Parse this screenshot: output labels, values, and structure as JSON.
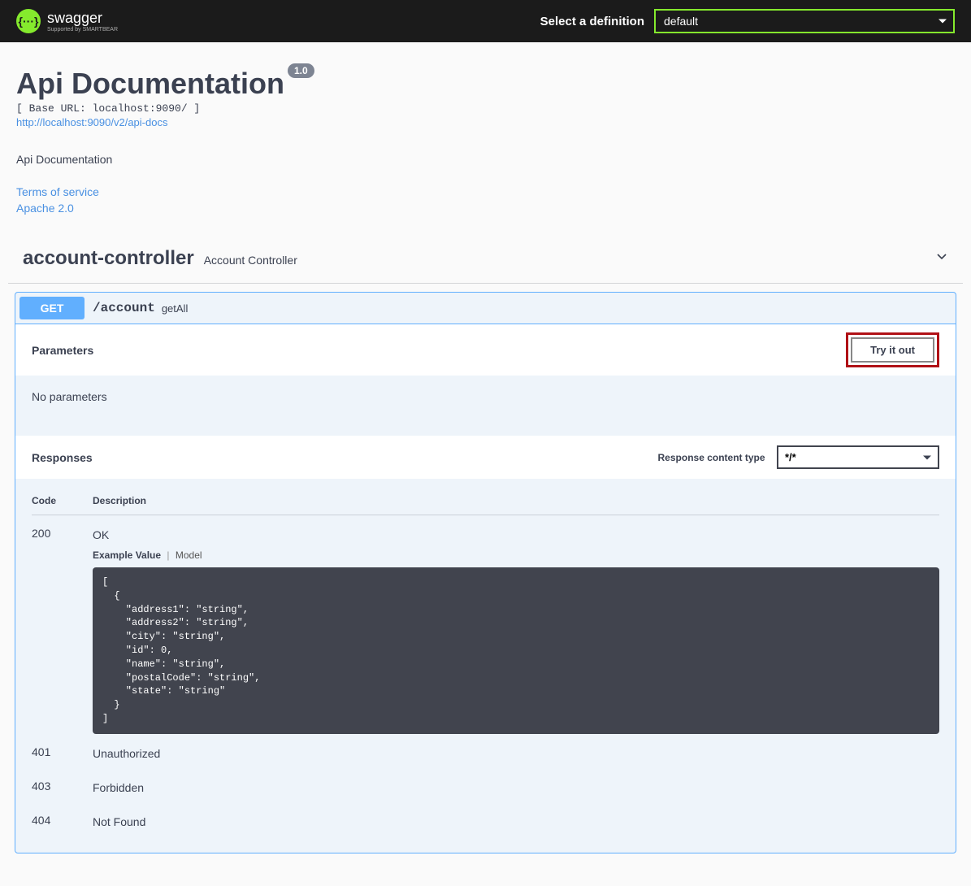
{
  "topbar": {
    "logo_text": "swagger",
    "logo_sub": "Supported by SMARTBEAR",
    "select_label": "Select a definition",
    "definition": "default"
  },
  "info": {
    "title": "Api Documentation",
    "version": "1.0",
    "base_url": "[ Base URL: localhost:9090/ ]",
    "docs_link": "http://localhost:9090/v2/api-docs",
    "description": "Api Documentation",
    "tos_label": "Terms of service",
    "license_label": "Apache 2.0"
  },
  "tag": {
    "name": "account-controller",
    "description": "Account Controller"
  },
  "operation": {
    "method": "GET",
    "path": "/account",
    "summary": "getAll",
    "parameters_label": "Parameters",
    "try_it_label": "Try it out",
    "no_params": "No parameters",
    "responses_label": "Responses",
    "content_type_label": "Response content type",
    "content_type_value": "*/*",
    "table": {
      "code_header": "Code",
      "desc_header": "Description"
    },
    "example_value_label": "Example Value",
    "model_label": "Model",
    "responses": {
      "r200": {
        "code": "200",
        "description": "OK"
      },
      "r401": {
        "code": "401",
        "description": "Unauthorized"
      },
      "r403": {
        "code": "403",
        "description": "Forbidden"
      },
      "r404": {
        "code": "404",
        "description": "Not Found"
      }
    },
    "example_body": "[\n  {\n    \"address1\": \"string\",\n    \"address2\": \"string\",\n    \"city\": \"string\",\n    \"id\": 0,\n    \"name\": \"string\",\n    \"postalCode\": \"string\",\n    \"state\": \"string\"\n  }\n]"
  }
}
